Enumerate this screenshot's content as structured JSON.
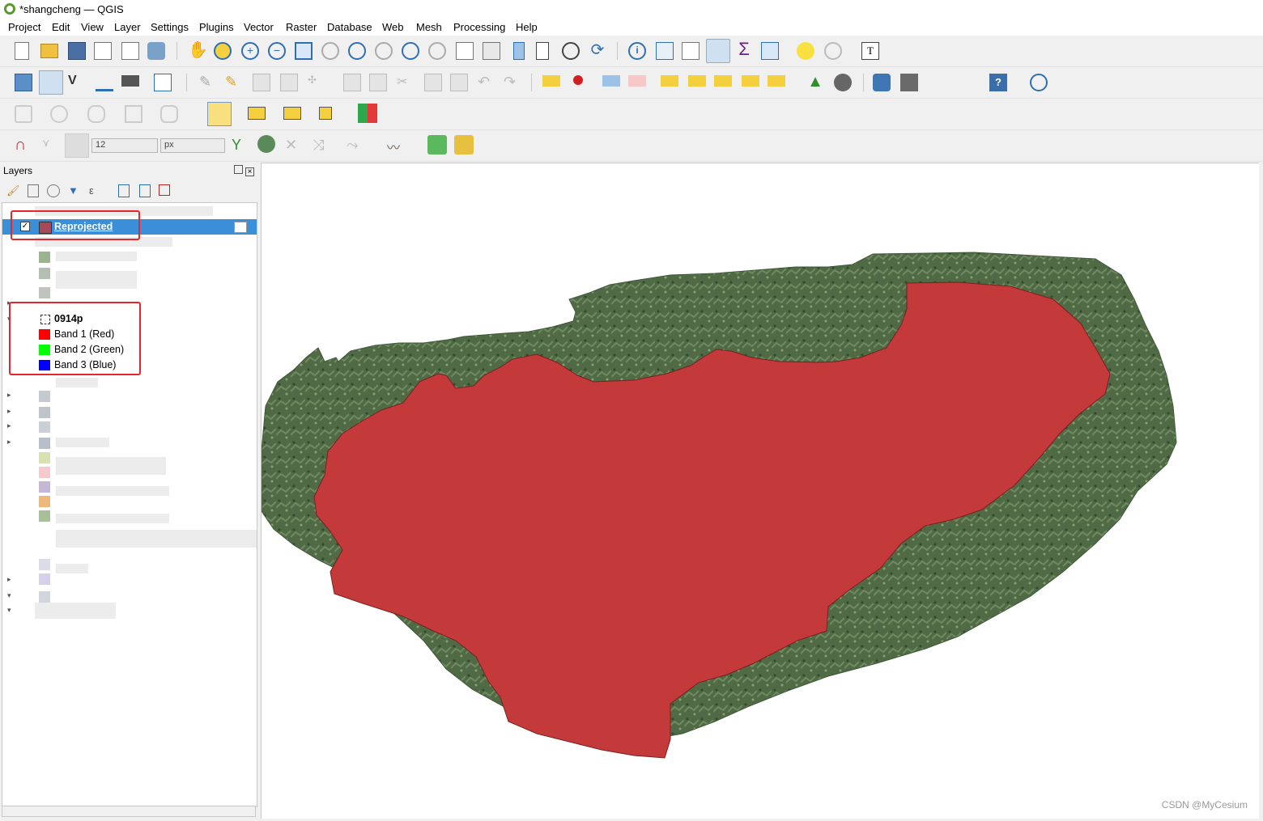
{
  "window": {
    "title": "*shangcheng — QGIS"
  },
  "menu": [
    "Project",
    "Edit",
    "View",
    "Layer",
    "Settings",
    "Plugins",
    "Vector",
    "Raster",
    "Database",
    "Web",
    "Mesh",
    "Processing",
    "Help"
  ],
  "digitizing": {
    "tolerance_value": "12",
    "unit": "px"
  },
  "layers_panel": {
    "title": "Layers",
    "items": [
      {
        "label": "Reprojected",
        "checked": true,
        "selected": true,
        "color": "#a8495a"
      },
      {
        "label": "0914p",
        "group": true
      },
      {
        "label": "Band 1 (Red)",
        "color": "#ff0000"
      },
      {
        "label": "Band 2 (Green)",
        "color": "#00ff00"
      },
      {
        "label": "Band 3 (Blue)",
        "color": "#0000ff"
      }
    ]
  },
  "colors": {
    "accent": "#3a8fd8",
    "highlight_box": "#e6262c",
    "polygon_fill": "#c43a3a",
    "terrain": "#4f6a45"
  },
  "watermark": "CSDN @MyCesium"
}
